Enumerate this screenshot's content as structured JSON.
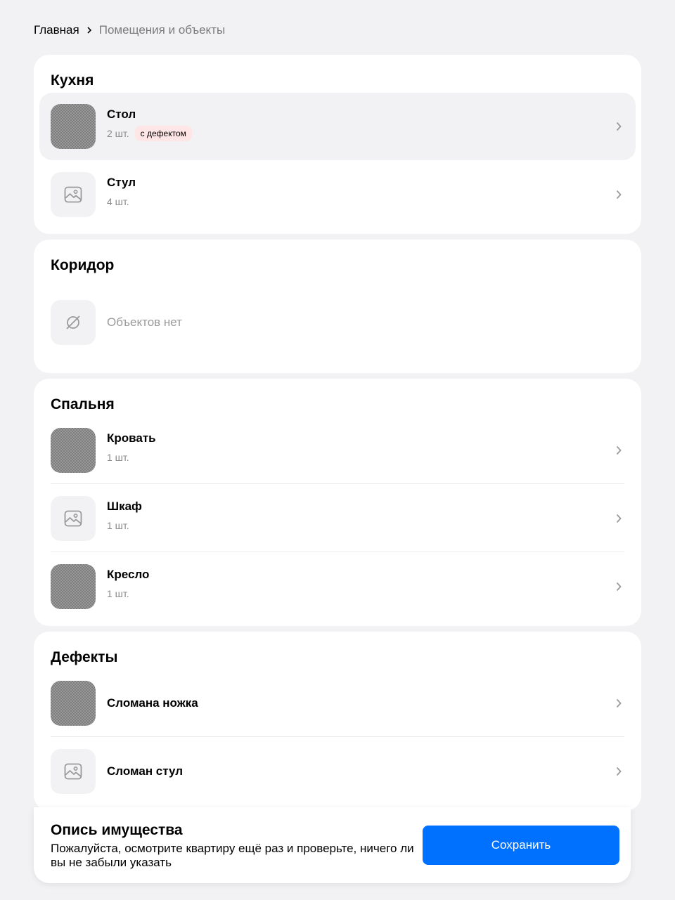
{
  "breadcrumb": {
    "home": "Главная",
    "current": "Помещения и объекты"
  },
  "rooms": [
    {
      "title": "Кухня",
      "items": [
        {
          "name": "Стол",
          "qty": "2 шт.",
          "badge": "с дефектом",
          "thumb": "photo"
        },
        {
          "name": "Стул",
          "qty": "4 шт.",
          "thumb": "image-placeholder-icon"
        }
      ]
    },
    {
      "title": "Коридор",
      "empty_text": "Объектов нет"
    },
    {
      "title": "Спальня",
      "items": [
        {
          "name": "Кровать",
          "qty": "1 шт.",
          "thumb": "photo"
        },
        {
          "name": "Шкаф",
          "qty": "1 шт.",
          "thumb": "image-placeholder-icon"
        },
        {
          "name": "Кресло",
          "qty": "1 шт.",
          "thumb": "photo"
        }
      ]
    },
    {
      "title": "Дефекты",
      "items": [
        {
          "name": "Сломана ножка",
          "thumb": "photo"
        },
        {
          "name": "Сломан стул",
          "thumb": "image-placeholder-icon"
        }
      ]
    }
  ],
  "footer": {
    "title": "Опись имущества",
    "text": "Пожалуйста, осмотрите квартиру ещё раз и проверьте, ничего ли вы не забыли указать",
    "save_label": "Сохранить"
  },
  "colors": {
    "background": "#f2f2f4",
    "accent": "#0070ff",
    "badge_bg": "#ffe6e6",
    "muted_text": "#8a8a8a"
  }
}
